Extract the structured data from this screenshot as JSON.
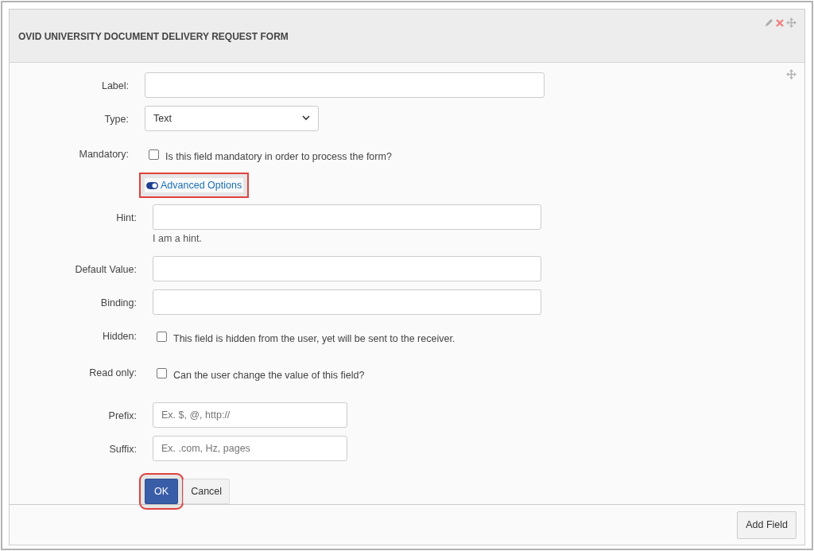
{
  "panel": {
    "title": "OVID UNIVERSITY DOCUMENT DELIVERY REQUEST FORM"
  },
  "basic_fields": [
    {
      "kind": "text",
      "label": "Label:"
    },
    {
      "kind": "select",
      "label": "Type:",
      "value": "Text"
    },
    {
      "kind": "checkbox",
      "label": "Mandatory:",
      "text": "Is this field mandatory in order to process the form?",
      "checked": false
    }
  ],
  "advanced_toggle": {
    "label": "Advanced Options",
    "on": true,
    "highlighted": true
  },
  "advanced_fields": [
    {
      "kind": "text",
      "label": "Hint:",
      "help": "I am a hint."
    },
    {
      "kind": "text",
      "label": "Default Value:"
    },
    {
      "kind": "text",
      "label": "Binding:"
    },
    {
      "kind": "checkbox",
      "label": "Hidden:",
      "text": "This field is hidden from the user, yet will be sent to the receiver.",
      "checked": false
    },
    {
      "kind": "checkbox",
      "label": "Read only:",
      "text": "Can the user change the value of this field?",
      "checked": false
    },
    {
      "kind": "short",
      "label": "Prefix:",
      "placeholder": "Ex. $, @, http://"
    },
    {
      "kind": "short",
      "label": "Suffix:",
      "placeholder": "Ex. .com, Hz, pages"
    }
  ],
  "buttons": [
    {
      "label": "OK",
      "kind": "primary",
      "highlighted": true
    },
    {
      "label": "Cancel",
      "kind": "secondary",
      "highlighted": false
    }
  ],
  "footer_button": "Add Field"
}
